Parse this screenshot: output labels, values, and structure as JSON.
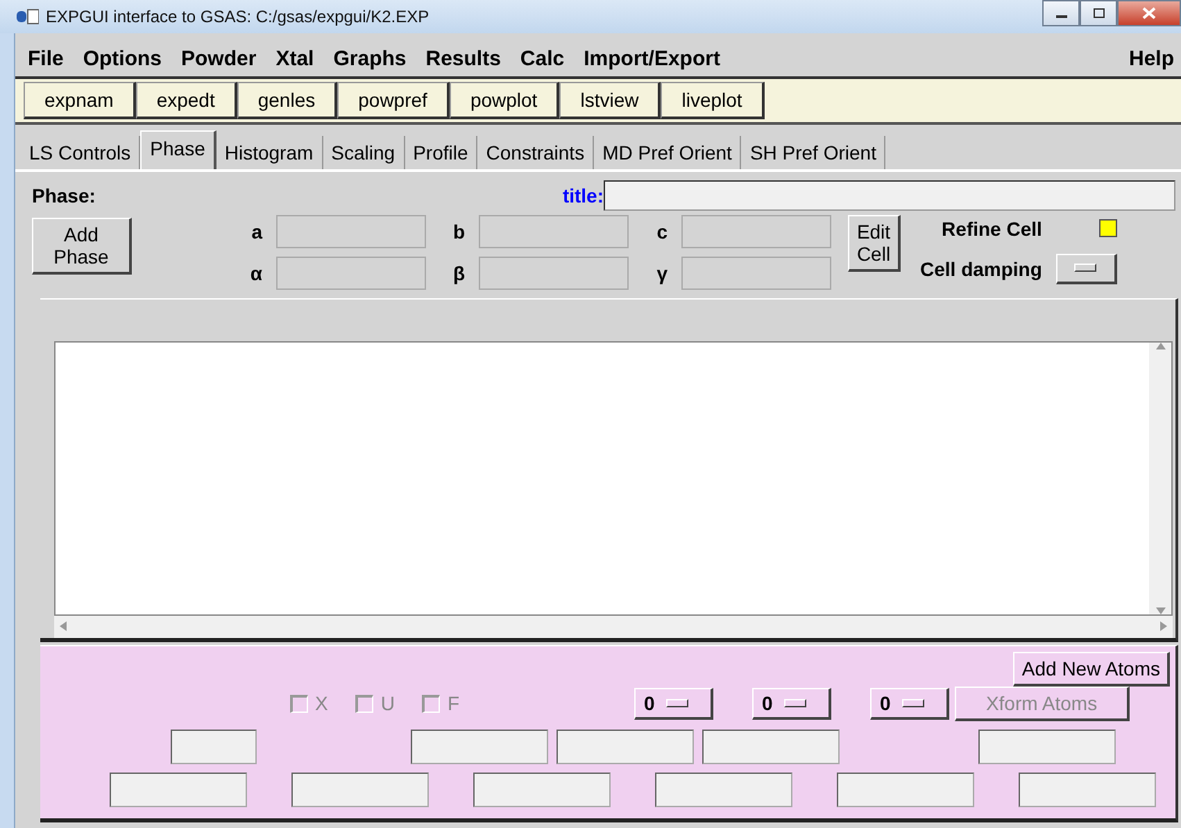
{
  "window": {
    "title": "EXPGUI interface to GSAS: C:/gsas/expgui/K2.EXP"
  },
  "menu": [
    "File",
    "Options",
    "Powder",
    "Xtal",
    "Graphs",
    "Results",
    "Calc",
    "Import/Export"
  ],
  "help_menu": "Help",
  "toolbar": [
    "expnam",
    "expedt",
    "genles",
    "powpref",
    "powplot",
    "lstview",
    "liveplot"
  ],
  "tabs": [
    {
      "label": "LS Controls",
      "selected": false
    },
    {
      "label": "Phase",
      "selected": true
    },
    {
      "label": "Histogram",
      "selected": false
    },
    {
      "label": "Scaling",
      "selected": false
    },
    {
      "label": "Profile",
      "selected": false
    },
    {
      "label": "Constraints",
      "selected": false
    },
    {
      "label": "MD Pref Orient",
      "selected": false
    },
    {
      "label": "SH Pref Orient",
      "selected": false
    }
  ],
  "phase_label": "Phase:",
  "title_label": "title:",
  "add_phase": "Add Phase",
  "cell_params": [
    [
      "a",
      "b",
      "c"
    ],
    [
      "α",
      "β",
      "γ"
    ]
  ],
  "edit_cell": "Edit Cell",
  "refine_cell": {
    "label": "Refine Cell",
    "checked": true
  },
  "cell_damping": "Cell damping",
  "atoms": {
    "add_button": "Add New Atoms",
    "flags": [
      {
        "label": "X",
        "checked": false,
        "disabled": true
      },
      {
        "label": "U",
        "checked": false,
        "disabled": true
      },
      {
        "label": "F",
        "checked": false,
        "disabled": true
      }
    ],
    "menus": [
      "0",
      "0",
      "0"
    ],
    "xform": {
      "label": "Xform Atoms",
      "disabled": true
    }
  }
}
